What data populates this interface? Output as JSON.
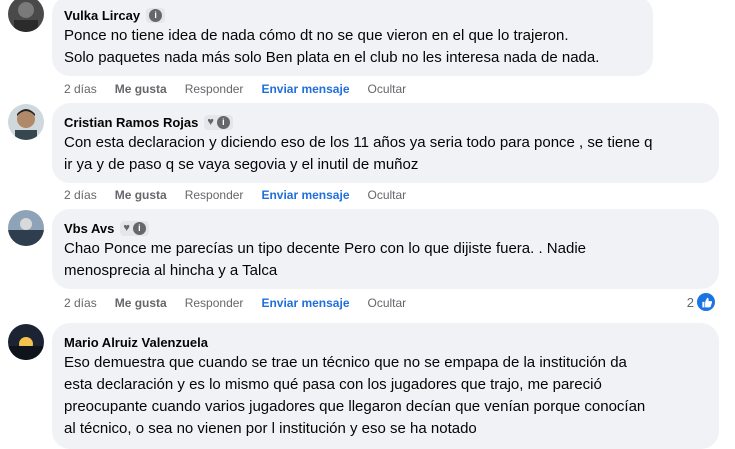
{
  "comments": [
    {
      "author": "Vulka Lircay",
      "text": "Ponce no tiene idea de nada cómo dt no se que vieron en el que lo trajeron.\nSolo paquetes nada más solo Ben plata en el club no les interesa nada de nada.",
      "time": "2 días",
      "like": "Me gusta",
      "reply": "Responder",
      "send": "Enviar mensaje",
      "hide": "Ocultar"
    },
    {
      "author": "Cristian Ramos Rojas",
      "text": "Con esta declaracion y diciendo eso de los 11 años ya seria todo para ponce , se tiene q\nir ya y de paso q se vaya segovia y el inutil de muñoz",
      "time": "2 días",
      "like": "Me gusta",
      "reply": "Responder",
      "send": "Enviar mensaje",
      "hide": "Ocultar"
    },
    {
      "author": "Vbs Avs",
      "text": "Chao Ponce me parecías un tipo decente Pero con lo que dijiste fuera. . Nadie\nmenosprecia al hincha y a Talca",
      "time": "2 días",
      "like": "Me gusta",
      "reply": "Responder",
      "send": "Enviar mensaje",
      "hide": "Ocultar",
      "reaction_count": "2"
    },
    {
      "author": "Mario Alruiz Valenzuela",
      "text": "Eso demuestra que cuando se trae un técnico que no se empapa de la institución da\nesta declaración y es lo mismo qué pasa con los jugadores que trajo, me pareció\npreocupante cuando varios jugadores que llegaron decían que venían porque conocían\nal técnico, o sea no vienen por l institución y eso se ha notado"
    }
  ],
  "colors": {
    "bubble": "#f0f2f5",
    "link": "#216fdb",
    "meta": "#65676b",
    "like_blue": "#1b74e4"
  }
}
